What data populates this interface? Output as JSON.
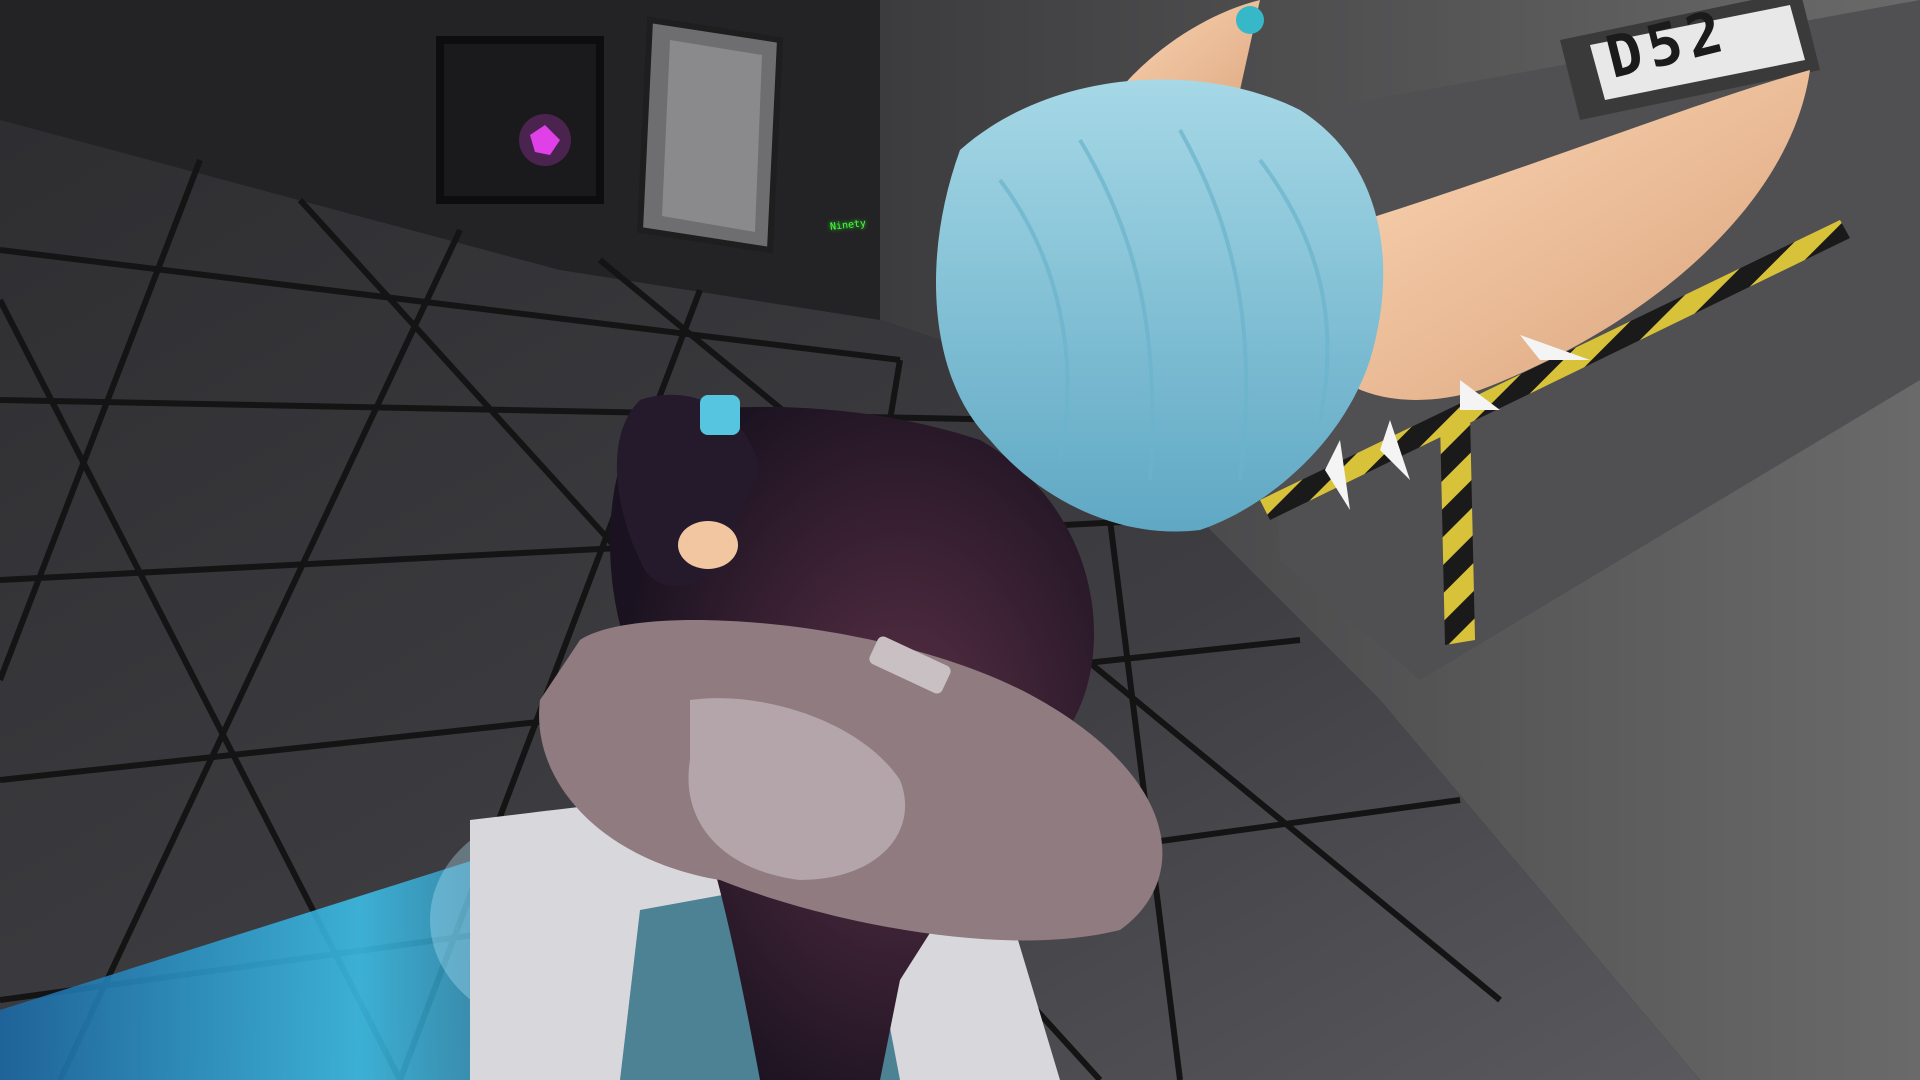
{
  "scene": {
    "room_number": "D52",
    "wall_label": "Ninety",
    "colors": {
      "floor": "#3a3a3d",
      "floor_lines": "#141415",
      "wall": "#4a4a4a",
      "ceiling": "#4a2a1a",
      "hair": "#8ac9dc",
      "ears": "#f2c6a0",
      "bodysuit": "#24182a",
      "jacket": "#8f7b80",
      "blue_effect": "#2aa8e0",
      "hazard_yellow": "#d8c23a",
      "pink_crystal": "#e040e8"
    },
    "elements": {
      "corridor": "dark-tiled-corridor",
      "door": "metal-door",
      "avatar": "anime-fox-avatar",
      "hazard": "hazard-stripes",
      "crystal": "pink-crystal",
      "light": "ceiling-light"
    }
  }
}
